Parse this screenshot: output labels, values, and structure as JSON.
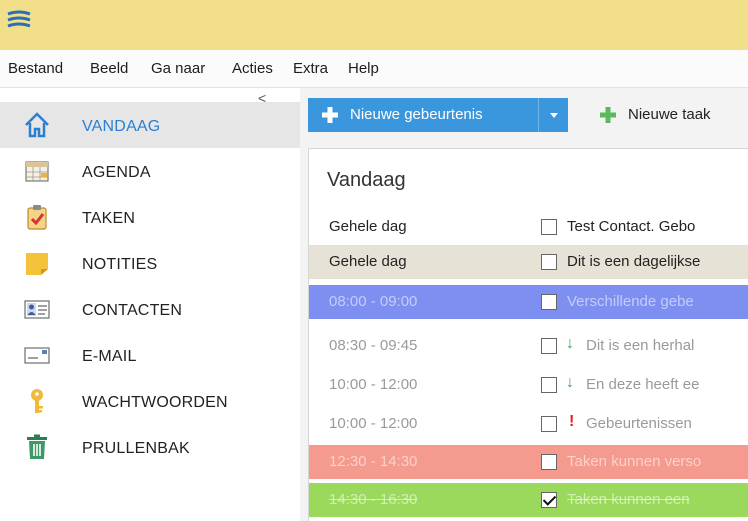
{
  "window": {
    "app_icon": "stacked-lines-icon",
    "titlebar_color": "#f2df8a"
  },
  "menu": {
    "items": [
      "Bestand",
      "Beeld",
      "Ga naar",
      "Acties",
      "Extra",
      "Help"
    ]
  },
  "sidebar": {
    "collapse_glyph": "<",
    "items": [
      {
        "label": "VANDAAG",
        "icon": "house-icon",
        "active": true
      },
      {
        "label": "AGENDA",
        "icon": "calendar-icon",
        "active": false
      },
      {
        "label": "TAKEN",
        "icon": "clipboard-check-icon",
        "active": false
      },
      {
        "label": "NOTITIES",
        "icon": "sticky-note-icon",
        "active": false
      },
      {
        "label": "CONTACTEN",
        "icon": "contact-card-icon",
        "active": false
      },
      {
        "label": "E-MAIL",
        "icon": "envelope-icon",
        "active": false
      },
      {
        "label": "WACHTWOORDEN",
        "icon": "key-icon",
        "active": false
      },
      {
        "label": "PRULLENBAK",
        "icon": "trash-icon",
        "active": false
      }
    ],
    "accent_color": "#2b7fd1"
  },
  "toolbar": {
    "new_event_label": "Nieuwe gebeurtenis",
    "new_task_label": "Nieuwe taak",
    "button_color": "#3a97de"
  },
  "today": {
    "title": "Vandaag",
    "rows": [
      {
        "time": "Gehele dag",
        "title": "Test Contact. Gebo",
        "checked": false,
        "bg": "#ffffff"
      },
      {
        "time": "Gehele dag",
        "title": "Dit is een dagelijkse",
        "checked": false,
        "bg": "#e6e3d6"
      },
      {
        "time": "08:00 - 09:00",
        "title": "Verschillende gebe",
        "checked": false,
        "bg": "#7d8ff0"
      },
      {
        "time": "08:30 - 09:45",
        "title": "Dit is een herhal",
        "checked": false,
        "bg": "#ffffff",
        "mark": "↓"
      },
      {
        "time": "10:00 - 12:00",
        "title": "En deze heeft ee",
        "checked": false,
        "bg": "#ffffff",
        "mark": "↓"
      },
      {
        "time": "10:00 - 12:00",
        "title": "Gebeurtenissen",
        "checked": false,
        "bg": "#ffffff",
        "mark": "!"
      },
      {
        "time": "12:30 - 14:30",
        "title": "Taken kunnen verso",
        "checked": false,
        "bg": "#f59a8e"
      },
      {
        "time": "14:30 - 16:30",
        "title": "Taken kunnen een",
        "checked": true,
        "bg": "#9bd95c"
      }
    ]
  }
}
